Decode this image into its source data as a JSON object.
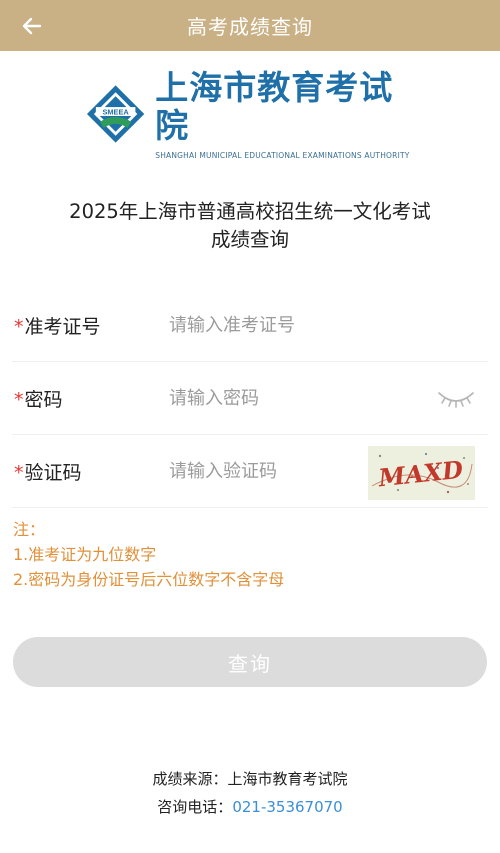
{
  "header": {
    "title": "高考成绩查询",
    "back_icon": "arrow-left-icon"
  },
  "logo": {
    "emblem_text": "SMEEA",
    "name_cn": "上海市教育考试院",
    "name_en": "SHANGHAI MUNICIPAL EDUCATIONAL EXAMINATIONS AUTHORITY"
  },
  "exam": {
    "title_line1": "2025年上海市普通高校招生统一文化考试",
    "title_line2": "成绩查询"
  },
  "form": {
    "required_mark": "*",
    "exam_id": {
      "label": "准考证号",
      "placeholder": "请输入准考证号",
      "value": ""
    },
    "password": {
      "label": "密码",
      "placeholder": "请输入密码",
      "value": "",
      "toggle_icon": "eye-closed-icon"
    },
    "captcha": {
      "label": "验证码",
      "placeholder": "请输入验证码",
      "value": "",
      "image_text": "MAXD"
    }
  },
  "notes": {
    "title": "注：",
    "items": [
      "1.准考证为九位数字",
      "2.密码为身份证号后六位数字不含字母"
    ]
  },
  "query_button": {
    "label": "查询"
  },
  "footer": {
    "source_label": "成绩来源：",
    "source_value": "上海市教育考试院",
    "phone_label": "咨询电话：",
    "phone_value": "021-35367070"
  },
  "colors": {
    "header_bg": "#c9b085",
    "logo_blue": "#1f6fa8",
    "required_red": "#e53935",
    "note_orange": "#e0913a",
    "button_disabled": "#dcdcdc",
    "link_blue": "#3a8fd6"
  }
}
